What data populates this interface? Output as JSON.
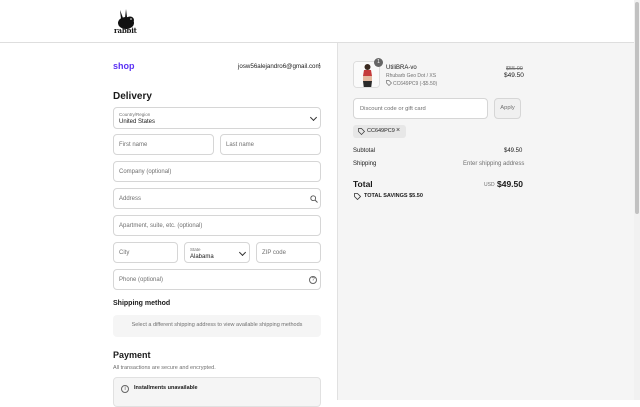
{
  "brand": {
    "logo_text": "rabbit"
  },
  "account": {
    "shop_label": "shop",
    "email": "josw56alejandro6@gmail.com",
    "menu_glyph": "⋮"
  },
  "delivery": {
    "heading": "Delivery",
    "country": {
      "label": "Country/Region",
      "value": "United States"
    },
    "first_name": {
      "placeholder": "First name"
    },
    "last_name": {
      "placeholder": "Last name"
    },
    "company": {
      "placeholder": "Company (optional)"
    },
    "address": {
      "placeholder": "Address"
    },
    "apartment": {
      "placeholder": "Apartment, suite, etc. (optional)"
    },
    "city": {
      "placeholder": "City"
    },
    "state": {
      "label": "State",
      "value": "Alabama"
    },
    "zip": {
      "placeholder": "ZIP code"
    },
    "phone": {
      "placeholder": "Phone (optional)"
    }
  },
  "shipping": {
    "heading": "Shipping method",
    "message": "Select a different shipping address to view available shipping methods"
  },
  "payment": {
    "heading": "Payment",
    "subtitle": "All transactions are secure and encrypted.",
    "notice_title": "Installments unavailable"
  },
  "cart": {
    "item": {
      "name": "UtiliBRA-vo",
      "variant": "Rhubarb Geo Dot / XS",
      "discount": "CC649PC9 (-$5.50)",
      "quantity": "1",
      "price_original": "$55.00",
      "price": "$49.50"
    },
    "discount_input": {
      "placeholder": "Discount code or gift card"
    },
    "apply_label": "Apply",
    "applied_code": "CC649PC9",
    "subtotal_label": "Subtotal",
    "subtotal_value": "$49.50",
    "shipping_label": "Shipping",
    "shipping_value": "Enter shipping address",
    "total_label": "Total",
    "currency": "USD",
    "total_value": "$49.50",
    "savings": "TOTAL SAVINGS  $5.50"
  },
  "colors": {
    "accent": "#5a31f4",
    "summary_bg": "#f5f5f5"
  }
}
